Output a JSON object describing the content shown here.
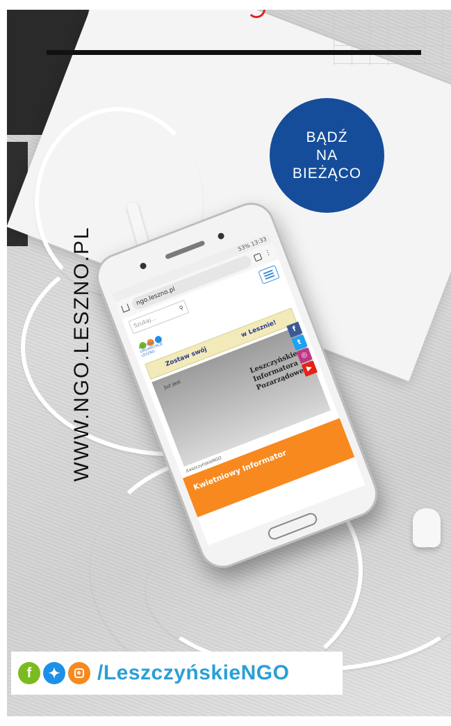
{
  "badge": {
    "text": "BĄDŹ\nNA\nBIEŻĄCO",
    "color": "#154d9b"
  },
  "vertical_url": "WWW.NGO.LESZNO.PL",
  "phone_screen": {
    "status": "53% 13:33",
    "url": "ngo.leszno.pl",
    "search_placeholder": "Szukaj...",
    "logo_caption": "AKTYWNE ORGANIZACJE LESZNO",
    "banner_left": "Zostaw swój",
    "banner_right": "w Lesznie!",
    "hero_title": "Leszczyńskiego\nInformatora\nPozarządowego",
    "hero_sub": "Już jest",
    "screen_social": "/LeszczyńskieNGO",
    "cta": "Kwietniowy Informator",
    "social_icons": [
      "facebook-icon",
      "twitter-icon",
      "instagram-icon",
      "youtube-icon"
    ]
  },
  "social_strip": {
    "icons": [
      "facebook-icon",
      "twitter-icon",
      "instagram-icon"
    ],
    "handle": "/LeszczyńskieNGO",
    "colors": {
      "facebook": "#7bbb1f",
      "twitter": "#1e90e8",
      "instagram": "#f7891f",
      "handle": "#2a9fd6"
    }
  }
}
